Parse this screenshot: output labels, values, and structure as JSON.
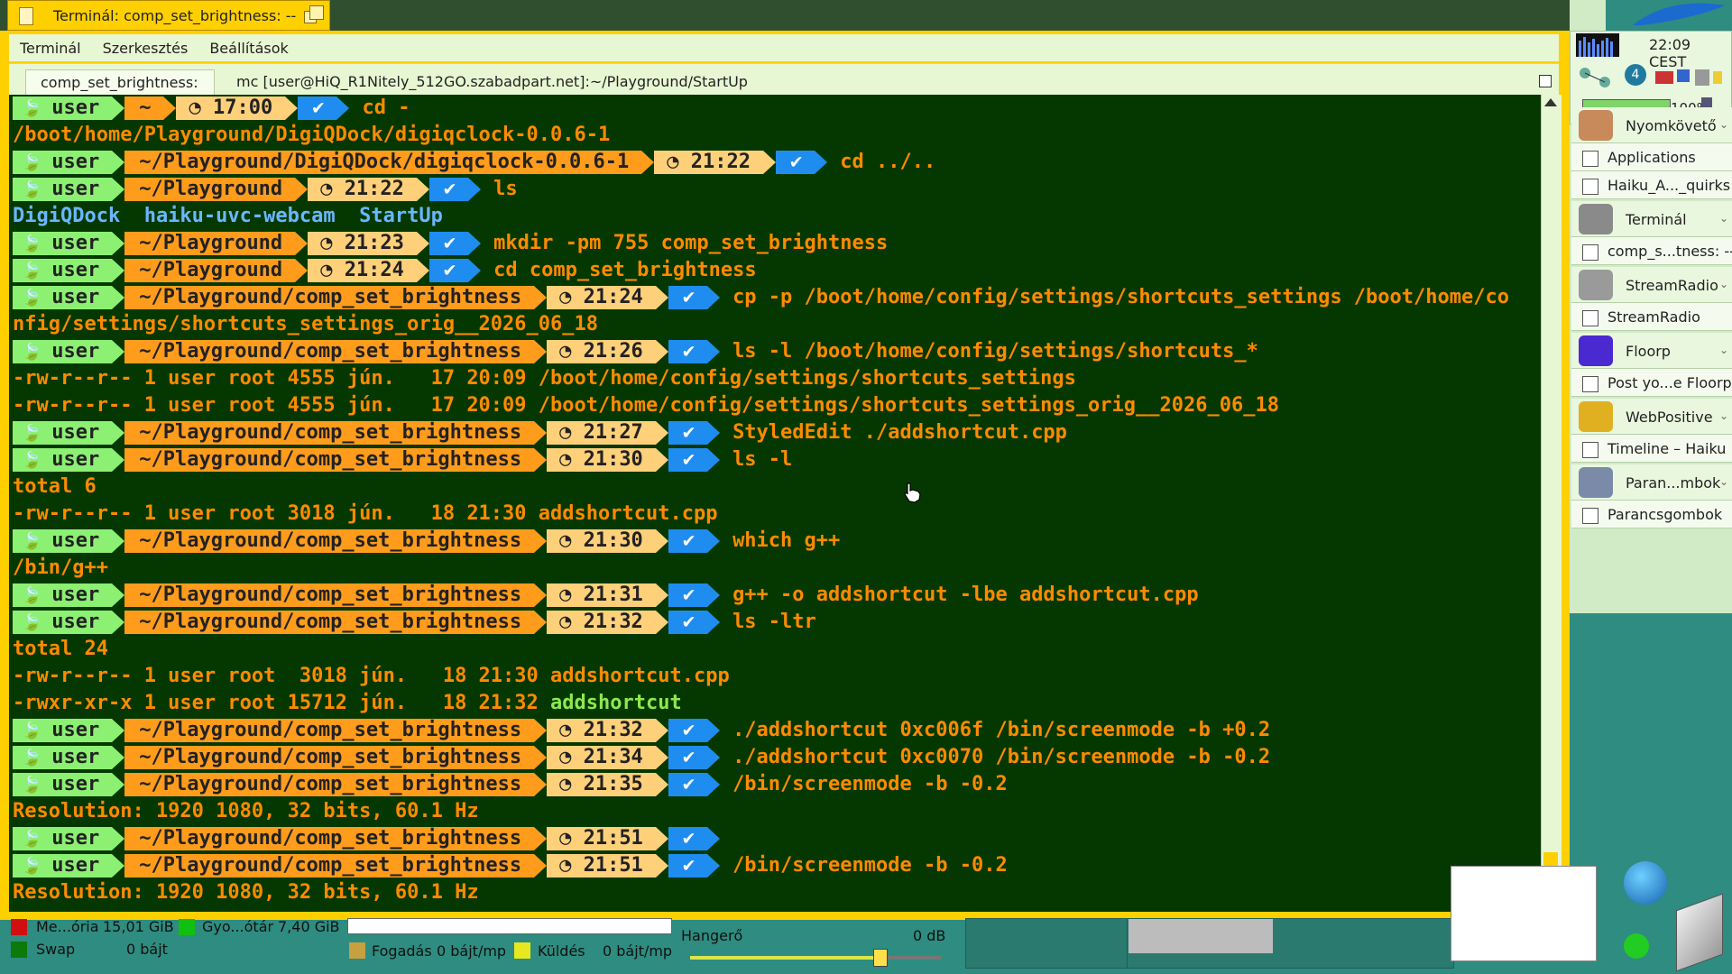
{
  "window": {
    "title": "Terminál: comp_set_brightness: --",
    "menu": [
      "Terminál",
      "Szerkesztés",
      "Beállítások"
    ],
    "tabs": [
      {
        "label": "comp_set_brightness: --",
        "active": true
      },
      {
        "label": "mc [user@HiQ_R1Nitely_512GO.szabadpart.net]:~/Playground/StartUp",
        "active": false
      }
    ]
  },
  "terminal": {
    "lines": [
      {
        "kind": "prompt",
        "user": "user",
        "path": "~",
        "time": "17:00",
        "cmd": "cd -"
      },
      {
        "kind": "out",
        "text": "/boot/home/Playground/DigiQDock/digiqclock-0.0.6-1",
        "color": "o"
      },
      {
        "kind": "prompt",
        "user": "user",
        "path": "~/Playground/DigiQDock/digiqclock-0.0.6-1",
        "time": "21:22",
        "cmd": "cd ../.."
      },
      {
        "kind": "prompt",
        "user": "user",
        "path": "~/Playground",
        "time": "21:22",
        "cmd": "ls"
      },
      {
        "kind": "out",
        "text": "DigiQDock  haiku-uvc-webcam  StartUp",
        "color": "c"
      },
      {
        "kind": "prompt",
        "user": "user",
        "path": "~/Playground",
        "time": "21:23",
        "cmd": "mkdir -pm 755 comp_set_brightness"
      },
      {
        "kind": "prompt",
        "user": "user",
        "path": "~/Playground",
        "time": "21:24",
        "cmd": "cd comp_set_brightness"
      },
      {
        "kind": "prompt",
        "user": "user",
        "path": "~/Playground/comp_set_brightness",
        "time": "21:24",
        "cmd": "cp -p /boot/home/config/settings/shortcuts_settings /boot/home/co"
      },
      {
        "kind": "out",
        "text": "nfig/settings/shortcuts_settings_orig__2026_06_18",
        "color": "o"
      },
      {
        "kind": "prompt",
        "user": "user",
        "path": "~/Playground/comp_set_brightness",
        "time": "21:26",
        "cmd": "ls -l /boot/home/config/settings/shortcuts_*"
      },
      {
        "kind": "out",
        "text": "-rw-r--r-- 1 user root 4555 jún.   17 20:09 /boot/home/config/settings/shortcuts_settings",
        "color": "o"
      },
      {
        "kind": "out",
        "text": "-rw-r--r-- 1 user root 4555 jún.   17 20:09 /boot/home/config/settings/shortcuts_settings_orig__2026_06_18",
        "color": "o"
      },
      {
        "kind": "prompt",
        "user": "user",
        "path": "~/Playground/comp_set_brightness",
        "time": "21:27",
        "cmd": "StyledEdit ./addshortcut.cpp"
      },
      {
        "kind": "prompt",
        "user": "user",
        "path": "~/Playground/comp_set_brightness",
        "time": "21:30",
        "cmd": "ls -l"
      },
      {
        "kind": "out",
        "text": "total 6",
        "color": "o"
      },
      {
        "kind": "out",
        "text": "-rw-r--r-- 1 user root 3018 jún.   18 21:30 addshortcut.cpp",
        "color": "o"
      },
      {
        "kind": "prompt",
        "user": "user",
        "path": "~/Playground/comp_set_brightness",
        "time": "21:30",
        "cmd": "which g++"
      },
      {
        "kind": "out",
        "text": "/bin/g++",
        "color": "o"
      },
      {
        "kind": "prompt",
        "user": "user",
        "path": "~/Playground/comp_set_brightness",
        "time": "21:31",
        "cmd": "g++ -o addshortcut -lbe addshortcut.cpp"
      },
      {
        "kind": "prompt",
        "user": "user",
        "path": "~/Playground/comp_set_brightness",
        "time": "21:32",
        "cmd": "ls -ltr"
      },
      {
        "kind": "out",
        "text": "total 24",
        "color": "o"
      },
      {
        "kind": "out",
        "text": "-rw-r--r-- 1 user root  3018 jún.   18 21:30 addshortcut.cpp",
        "color": "o"
      },
      {
        "kind": "out2",
        "text": "-rwxr-xr-x 1 user root 15712 jún.   18 21:32 ",
        "text2": "addshortcut"
      },
      {
        "kind": "prompt",
        "user": "user",
        "path": "~/Playground/comp_set_brightness",
        "time": "21:32",
        "cmd": "./addshortcut 0xc006f /bin/screenmode -b +0.2"
      },
      {
        "kind": "prompt",
        "user": "user",
        "path": "~/Playground/comp_set_brightness",
        "time": "21:34",
        "cmd": "./addshortcut 0xc0070 /bin/screenmode -b -0.2"
      },
      {
        "kind": "prompt",
        "user": "user",
        "path": "~/Playground/comp_set_brightness",
        "time": "21:35",
        "cmd": "/bin/screenmode -b -0.2"
      },
      {
        "kind": "out",
        "text": "Resolution: 1920 1080, 32 bits, 60.1 Hz",
        "color": "o"
      },
      {
        "kind": "prompt",
        "user": "user",
        "path": "~/Playground/comp_set_brightness",
        "time": "21:51",
        "cmd": ""
      },
      {
        "kind": "prompt",
        "user": "user",
        "path": "~/Playground/comp_set_brightness",
        "time": "21:51",
        "cmd": "/bin/screenmode -b -0.2"
      },
      {
        "kind": "out",
        "text": "Resolution: 1920 1080, 32 bits, 60.1 Hz",
        "color": "o"
      }
    ]
  },
  "deskbar": {
    "clock": "22:09 CEST",
    "battery_percent": "100%",
    "workspace_number": "4",
    "items": [
      {
        "label": "Nyomkövető",
        "type": "app",
        "icon": "dog-icon"
      },
      {
        "label": "Applications",
        "type": "window"
      },
      {
        "label": "Haiku_A..._quirks",
        "type": "window"
      },
      {
        "label": "Terminál",
        "type": "app",
        "icon": "terminal-icon"
      },
      {
        "label": "comp_s...tness: --",
        "type": "window"
      },
      {
        "label": "StreamRadio",
        "type": "app",
        "icon": "speaker-icon"
      },
      {
        "label": "StreamRadio",
        "type": "window"
      },
      {
        "label": "Floorp",
        "type": "app",
        "icon": "floorp-icon"
      },
      {
        "label": "Post yo...e Floorp",
        "type": "window"
      },
      {
        "label": "WebPositive",
        "type": "app",
        "icon": "webpositive-icon"
      },
      {
        "label": "Timeline – Haiku",
        "type": "window"
      },
      {
        "label": "Paran...mbok",
        "type": "app",
        "icon": "keyboard-icon"
      },
      {
        "label": "Parancsgombok",
        "type": "window"
      }
    ]
  },
  "status": {
    "memory_label": "Me...ória",
    "memory_value": "15,01 GiB",
    "cache_label": "Gyo...ótár",
    "cache_value": "7,40 GiB",
    "swap_label": "Swap",
    "swap_value": "0 bájt",
    "recv_label": "Fogadás",
    "recv_value": "0 bájt/mp",
    "send_label": "Küldés",
    "send_value": "0 bájt/mp",
    "volume_label": "Hangerő",
    "volume_db": "0 dB",
    "volume_level": 0.76
  },
  "colors": {
    "terminal_bg": "#053800",
    "user_seg": "#8cf073",
    "path_seg": "#ff9c1c",
    "time_seg": "#ffd07a",
    "ok_seg": "#1f8cf0",
    "tab_yellow": "#ffd000"
  }
}
